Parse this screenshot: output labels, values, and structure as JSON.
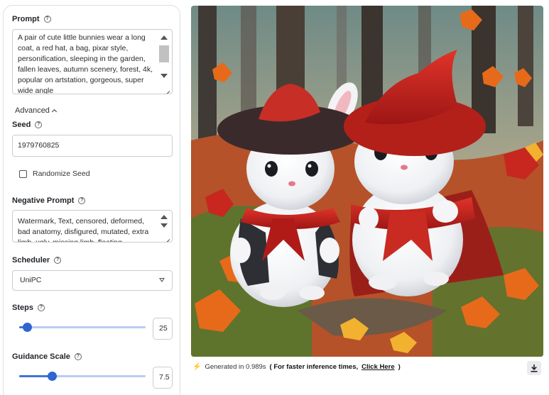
{
  "prompt": {
    "label": "Prompt",
    "value": "A pair of cute little bunnies wear a long coat, a red hat, a bag, pixar style, personification, sleeping in the garden, fallen leaves, autumn scenery, forest, 4k, popular on artstation, gorgeous, super wide angle"
  },
  "advanced": {
    "label": "Advanced"
  },
  "seed": {
    "label": "Seed",
    "value": "1979760825"
  },
  "randomize_seed": {
    "label": "Randomize Seed",
    "checked": false
  },
  "negative_prompt": {
    "label": "Negative Prompt",
    "value": "Watermark, Text, censored, deformed, bad anatomy, disfigured, mutated, extra limb, ugly, missing limb, floating"
  },
  "scheduler": {
    "label": "Scheduler",
    "value": "UniPC"
  },
  "steps": {
    "label": "Steps",
    "value": "25",
    "fraction": 0.06
  },
  "guidance": {
    "label": "Guidance Scale",
    "value": "7.5",
    "fraction": 0.26
  },
  "result": {
    "generated_prefix": "Generated in 0.989s",
    "faster_text_open": "( For faster inference times,",
    "click_here": "Click Here",
    "faster_text_close": ")"
  },
  "icons": {
    "help": "question-circle-icon",
    "bolt": "lightning-bolt-icon",
    "download": "download-icon",
    "chevron": "chevron-up-icon"
  },
  "colors": {
    "accent": "#2f66cf",
    "bolt": "#f59e0b"
  }
}
